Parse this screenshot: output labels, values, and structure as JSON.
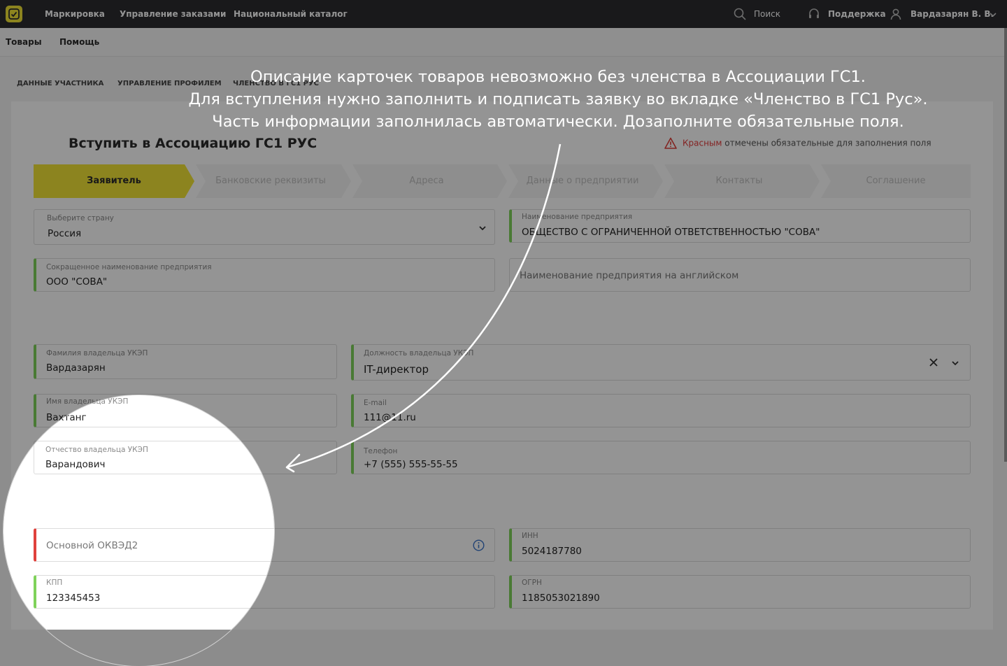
{
  "topbar": {
    "nav": [
      "Маркировка",
      "Управление заказами",
      "Национальный каталог"
    ],
    "search_label": "Поиск",
    "support_label": "Поддержка",
    "user_name": "Вардазарян В. В."
  },
  "subnav": [
    "Товары",
    "Помощь"
  ],
  "profile_tabs": [
    "Данные участника",
    "Управление профилем",
    "Членство в ГС1 Рус"
  ],
  "page_title": "Вступить в Ассоциацию ГС1 РУС",
  "required_note": {
    "red_word": "Красным",
    "rest": " отмечены обязательные для заполнения поля"
  },
  "steps": [
    "Заявитель",
    "Банковские реквизиты",
    "Адреса",
    "Данные о предприятии",
    "Контакты",
    "Соглашение"
  ],
  "fields": {
    "country": {
      "label": "Выберите страну",
      "value": "Россия"
    },
    "company_name": {
      "label": "Наименование предприятия",
      "value": "ОБЩЕСТВО С ОГРАНИЧЕННОЙ ОТВЕТСТВЕННОСТЬЮ \"СОВА\""
    },
    "short_name": {
      "label": "Сокращенное наименование предприятия",
      "value": "ООО \"СОВА\""
    },
    "english_name": {
      "placeholder": "Наименование предприятия на английском"
    },
    "last_name": {
      "label": "Фамилия владельца УКЭП",
      "value": "Вардазарян"
    },
    "position": {
      "label": "Должность владельца УКЭП",
      "value": "IT-директор"
    },
    "first_name": {
      "label": "Имя владельца УКЭП",
      "value": "Вахтанг"
    },
    "email": {
      "label": "E-mail",
      "value": "111@11.ru"
    },
    "patronymic": {
      "label": "Отчество владельца УКЭП",
      "value": "Варандович"
    },
    "phone": {
      "label": "Телефон",
      "value": "+7 (555) 555-55-55"
    },
    "okved": {
      "placeholder": "Основной ОКВЭД2"
    },
    "inn": {
      "label": "ИНН",
      "value": "5024187780"
    },
    "kpp": {
      "label": "КПП",
      "value": "123345453"
    },
    "ogrn": {
      "label": "ОГРН",
      "value": "1185053021890"
    }
  },
  "hint": {
    "line1": "Описание карточек товаров невозможно без членства в Ассоциации ГС1.",
    "line2": "Для вступления нужно заполнить и подписать заявку во вкладке «Членство в ГС1 Рус».",
    "line3": "Часть информации заполнилась автоматически. Дозаполните обязательные поля."
  },
  "colors": {
    "topbar": "#2b2c30",
    "accent_yellow": "#f1e436",
    "required_red": "#e0413c",
    "filled_green": "#7fd25a"
  }
}
